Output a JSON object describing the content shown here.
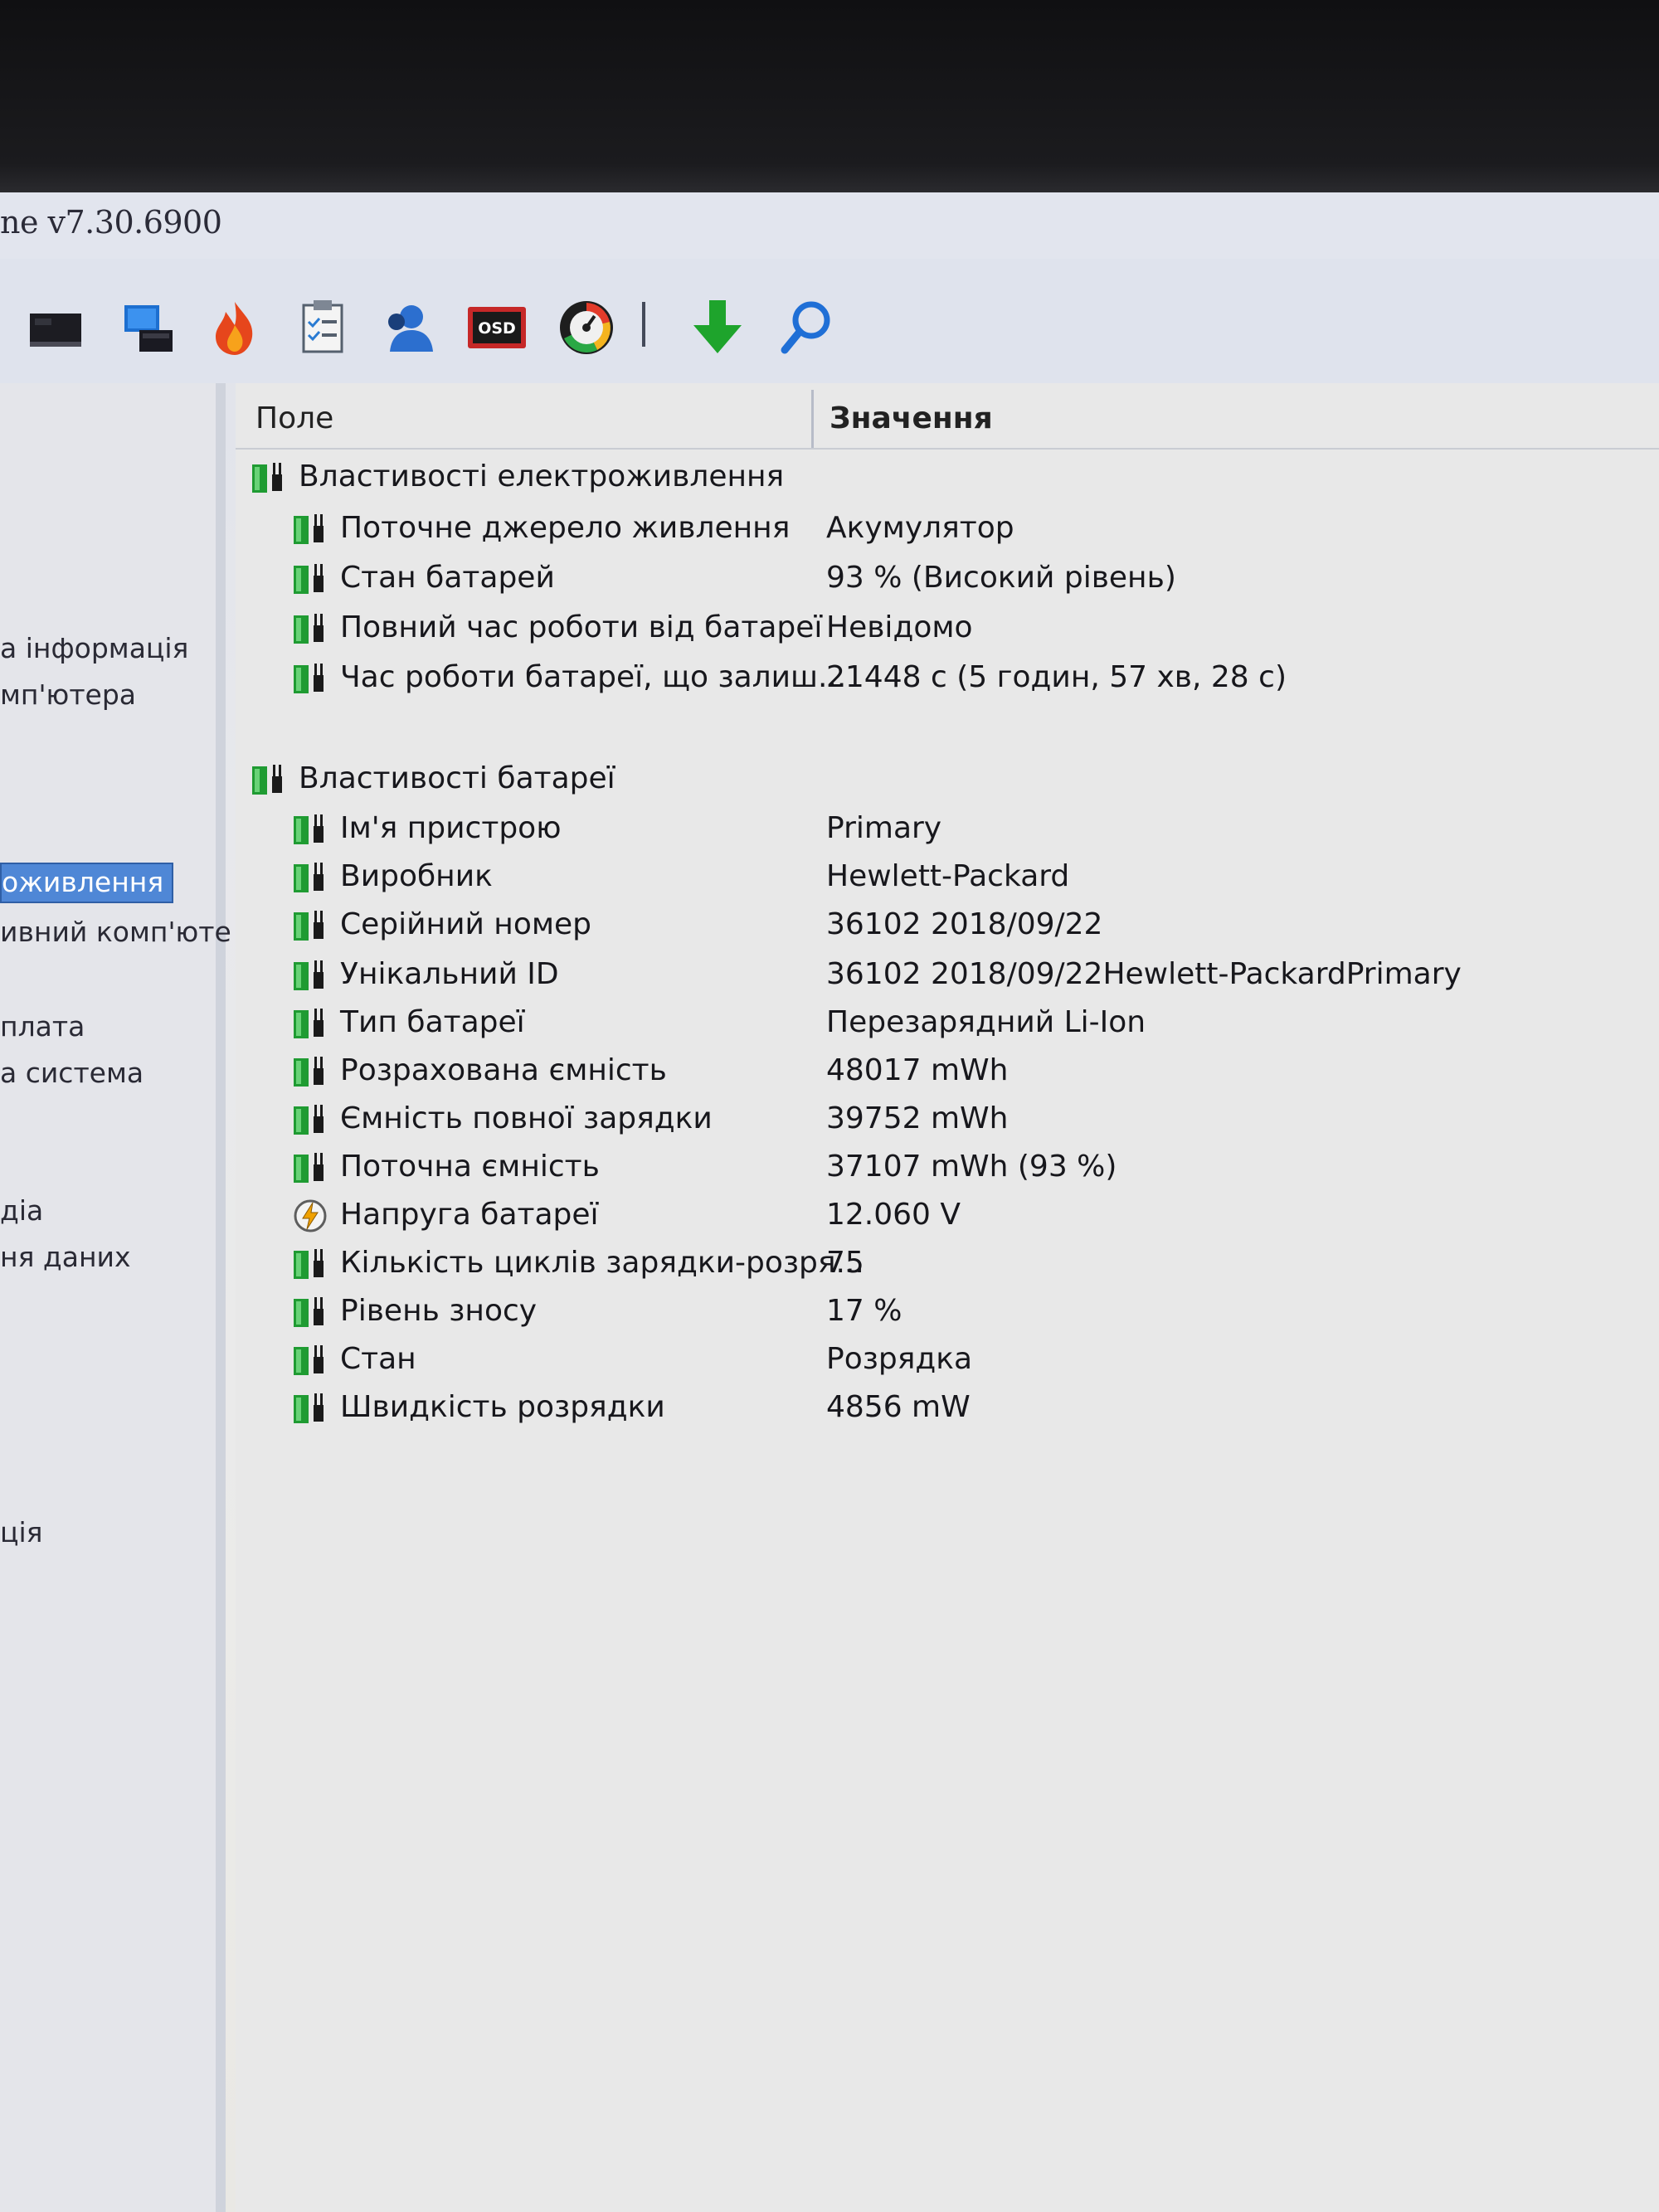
{
  "window": {
    "title": "ne v7.30.6900"
  },
  "toolbar": {
    "buttons": [
      {
        "icon": "motherboard-icon"
      },
      {
        "icon": "computer-network-icon"
      },
      {
        "icon": "flame-icon"
      },
      {
        "icon": "checklist-icon"
      },
      {
        "icon": "user-icon"
      },
      {
        "icon": "osd-icon",
        "label": "OSD"
      },
      {
        "icon": "gauge-icon"
      },
      {
        "icon": "download-arrow-icon"
      },
      {
        "icon": "search-icon"
      }
    ]
  },
  "sidebar": {
    "items": [
      {
        "label": "а інформація"
      },
      {
        "label": "мп'ютера"
      },
      {
        "label": "оживлення",
        "selected": true
      },
      {
        "label": "ивний комп'юте"
      },
      {
        "label": "плата"
      },
      {
        "label": "а система"
      },
      {
        "label": "діа"
      },
      {
        "label": "ня даних"
      },
      {
        "label": "ція"
      }
    ]
  },
  "table": {
    "headers": {
      "field": "Поле",
      "value": "Значення"
    },
    "groups": [
      {
        "label": "Властивості електроживлення",
        "rows": [
          {
            "field": "Поточне джерело живлення",
            "value": "Акумулятор"
          },
          {
            "field": "Стан батарей",
            "value": "93 % (Високий рівень)"
          },
          {
            "field": "Повний час роботи від батареї",
            "value": "Невідомо"
          },
          {
            "field": "Час роботи батареї, що залиш...",
            "value": "21448 с (5 годин, 57 хв, 28 с)"
          }
        ]
      },
      {
        "label": "Властивості батареї",
        "rows": [
          {
            "field": "Ім'я пристрою",
            "value": "Primary"
          },
          {
            "field": "Виробник",
            "value": "Hewlett-Packard"
          },
          {
            "field": "Серійний номер",
            "value": "36102 2018/09/22"
          },
          {
            "field": "Унікальний ID",
            "value": "36102 2018/09/22Hewlett-PackardPrimary"
          },
          {
            "field": "Тип батареї",
            "value": "Перезарядний Li-Ion"
          },
          {
            "field": "Розрахована ємність",
            "value": "48017 mWh"
          },
          {
            "field": "Ємність повної зарядки",
            "value": "39752 mWh"
          },
          {
            "field": "Поточна ємність",
            "value": "37107 mWh  (93 %)"
          },
          {
            "field": "Напруга батареї",
            "value": "12.060 V",
            "icon": "voltage-icon"
          },
          {
            "field": "Кількість циклів зарядки-розря...",
            "value": "75"
          },
          {
            "field": "Рівень зносу",
            "value": "17 %"
          },
          {
            "field": "Стан",
            "value": "Розрядка"
          },
          {
            "field": "Швидкість розрядки",
            "value": "4856 mW"
          }
        ]
      }
    ]
  },
  "colors": {
    "battery_green": "#1f9b32",
    "selection_blue": "#4f87d6",
    "download_green": "#1ea42c",
    "search_blue": "#1f6fd6"
  }
}
